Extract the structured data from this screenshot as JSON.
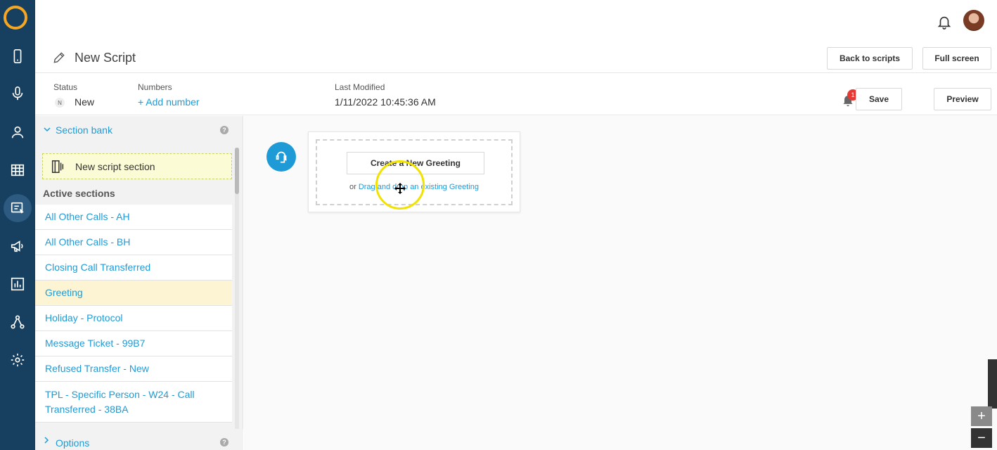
{
  "rail": {
    "items": [
      "phone-icon",
      "microphone-icon",
      "user-icon",
      "table-icon",
      "script-icon",
      "megaphone-icon",
      "chart-icon",
      "network-icon",
      "settings-icon"
    ],
    "active_index": 4
  },
  "header": {
    "title": "New Script",
    "back_label": "Back to scripts",
    "fullscreen_label": "Full screen"
  },
  "meta": {
    "status_label": "Status",
    "status_badge": "N",
    "status_value": "New",
    "numbers_label": "Numbers",
    "add_number": "+ Add number",
    "modified_label": "Last Modified",
    "modified_value": "1/11/2022 10:45:36 AM",
    "notification_count": "1",
    "save_label": "Save",
    "preview_label": "Preview"
  },
  "sidebar": {
    "section_bank_label": "Section bank",
    "help_glyph": "?",
    "new_section_label": "New script section",
    "active_sections_label": "Active sections",
    "sections": [
      "All Other Calls - AH",
      "All Other Calls - BH",
      "Closing Call Transferred",
      "Greeting",
      "Holiday - Protocol",
      "Message Ticket - 99B7",
      "Refused Transfer - New",
      "TPL - Specific Person - W24 - Call Transferred - 38BA"
    ],
    "highlighted_index": 3,
    "options_label": "Options"
  },
  "canvas": {
    "create_label": "Create a New Greeting",
    "drag_prefix": "or ",
    "drag_link": "Drag and drop an existing Greeting"
  },
  "zoom": {
    "plus": "+",
    "minus": "−"
  },
  "colors": {
    "rail": "#173f5f",
    "accent": "#1e9bd7",
    "logo": "#f5a623",
    "highlight": "#fcf4d2"
  }
}
